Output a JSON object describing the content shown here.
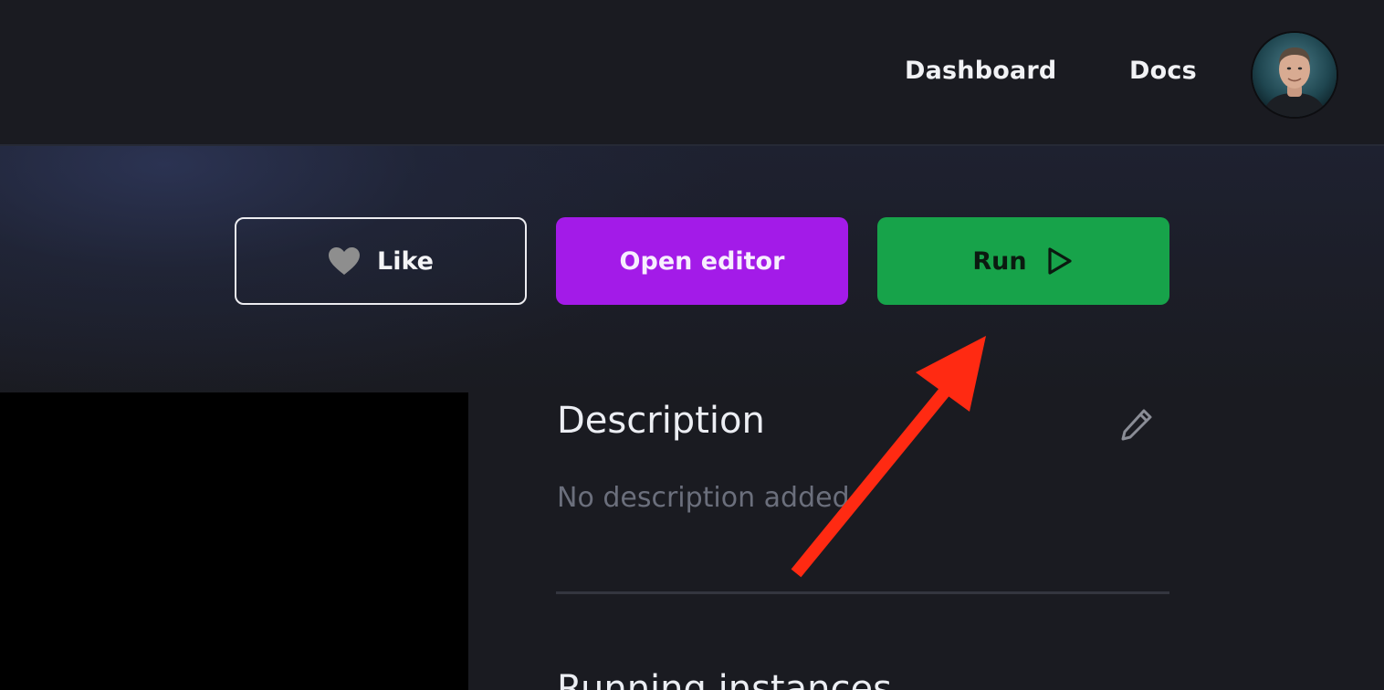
{
  "nav": {
    "dashboard_label": "Dashboard",
    "docs_label": "Docs",
    "avatar_icon": "user-avatar"
  },
  "actions": {
    "like_label": "Like",
    "like_icon": "heart-icon",
    "editor_label": "Open editor",
    "run_label": "Run",
    "run_icon": "play-icon"
  },
  "description": {
    "title": "Description",
    "body": "No description added",
    "edit_icon": "pencil-icon"
  },
  "running": {
    "title": "Running instances"
  },
  "colors": {
    "background": "#1a1b21",
    "editor_button": "#a31be8",
    "run_button": "#17a34a",
    "annotation_arrow": "#ff2a12"
  }
}
